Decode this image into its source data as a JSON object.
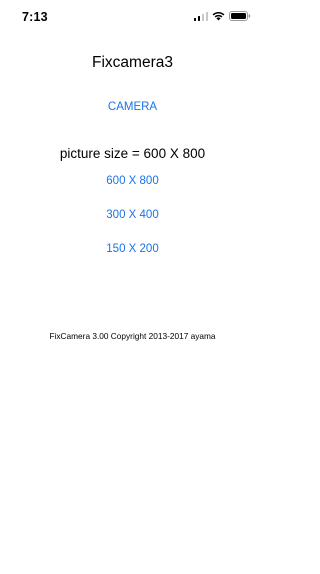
{
  "status_bar": {
    "time": "7:13",
    "icons": [
      "signal-icon",
      "wifi-icon",
      "battery-icon"
    ]
  },
  "app": {
    "title": "Fixcamera3",
    "camera_label": "CAMERA",
    "picture_size_text": "picture size = 600 X 800",
    "size_options": [
      "600 X 800",
      "300 X 400",
      "150 X 200"
    ],
    "copyright": "FixCamera 3.00 Copyright 2013-2017 ayama"
  },
  "colors": {
    "link": "#1a73e8",
    "text": "#000000",
    "background": "#ffffff"
  }
}
